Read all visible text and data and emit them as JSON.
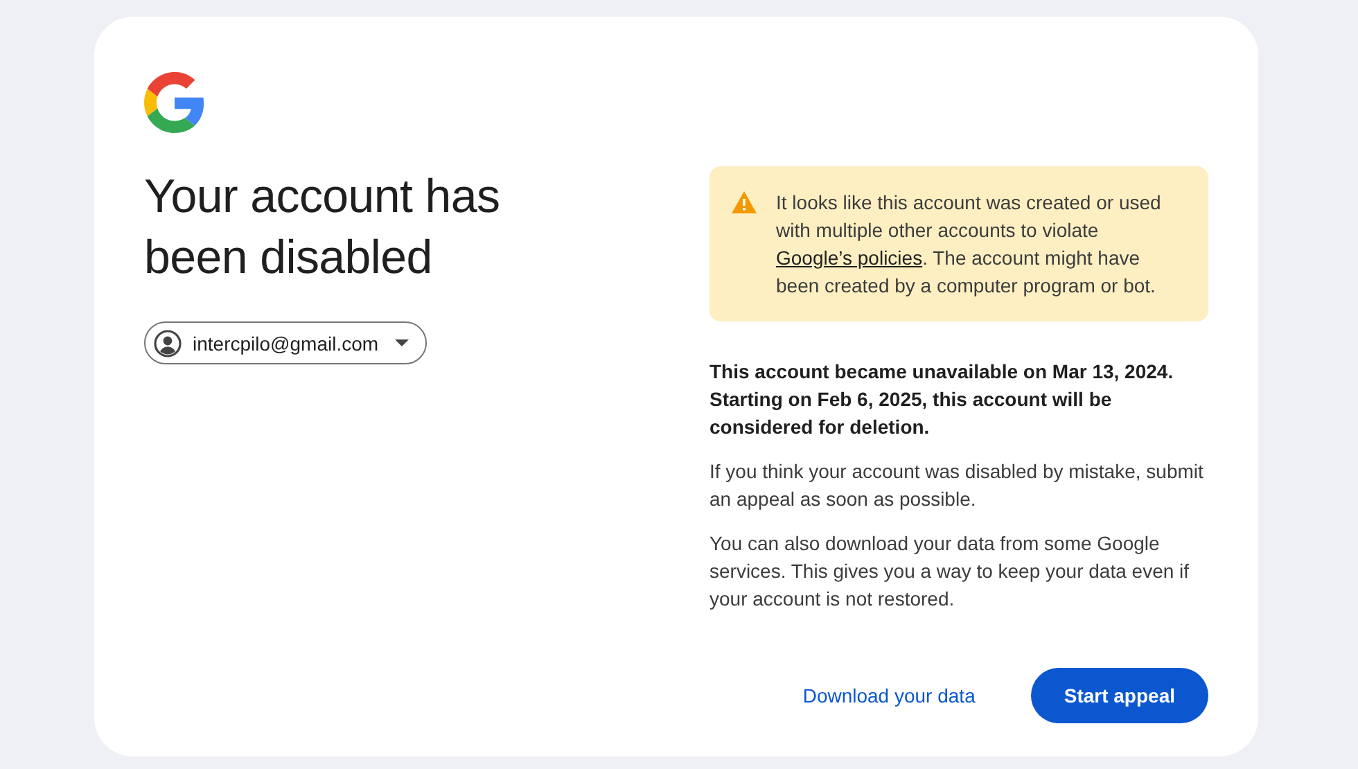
{
  "title": "Your account has been disabled",
  "account": {
    "email": "intercpilo@gmail.com"
  },
  "warning": {
    "text_before": "It looks like this account was created or used with multiple other accounts to violate ",
    "link": "Google’s policies",
    "text_after": ". The account might have been created by a computer program or bot."
  },
  "paragraphs": [
    {
      "kind": "bold",
      "text": "This account became unavailable on Mar 13, 2024. Starting on Feb 6, 2025, this account will be considered for deletion."
    },
    {
      "kind": "plain",
      "text": "If you think your account was disabled by mistake, submit an appeal as soon as possible."
    },
    {
      "kind": "plain",
      "text": "You can also download your data from some Google services. This gives you a way to keep your data even if your account is not restored."
    }
  ],
  "actions": [
    {
      "kind": "text",
      "label": "Download your data"
    },
    {
      "kind": "filled",
      "label": "Start appeal"
    }
  ]
}
